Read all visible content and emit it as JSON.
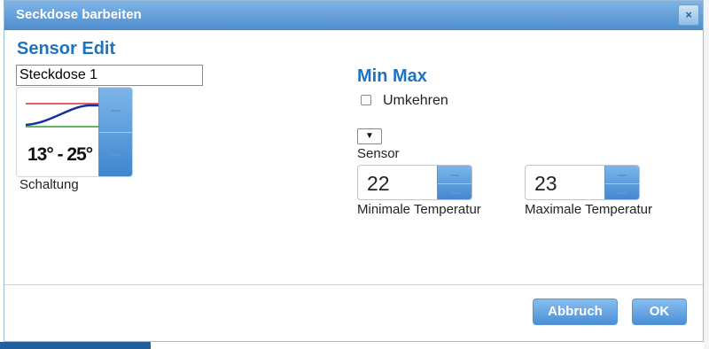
{
  "dialog": {
    "title": "Seckdose barbeiten",
    "close_glyph": "×"
  },
  "left": {
    "heading": "Sensor Edit",
    "name_value": "Steckdose 1",
    "thumbnail_label": "13° - 25°",
    "schaltung_label": "Schaltung"
  },
  "right": {
    "heading": "Min Max",
    "invert_checkbox_label": "Umkehren",
    "invert_checked": false,
    "sensor_select_value": "▼",
    "sensor_label": "Sensor",
    "min_temp_value": "22",
    "min_temp_label": "Minimale Temperatur",
    "max_temp_value": "23",
    "max_temp_label": "Maximale Temperatur"
  },
  "footer": {
    "cancel_label": "Abbruch",
    "ok_label": "OK"
  },
  "colors": {
    "accent": "#1e73be",
    "titlebar": "#4f8ecf",
    "button": "#4b8fd6"
  }
}
